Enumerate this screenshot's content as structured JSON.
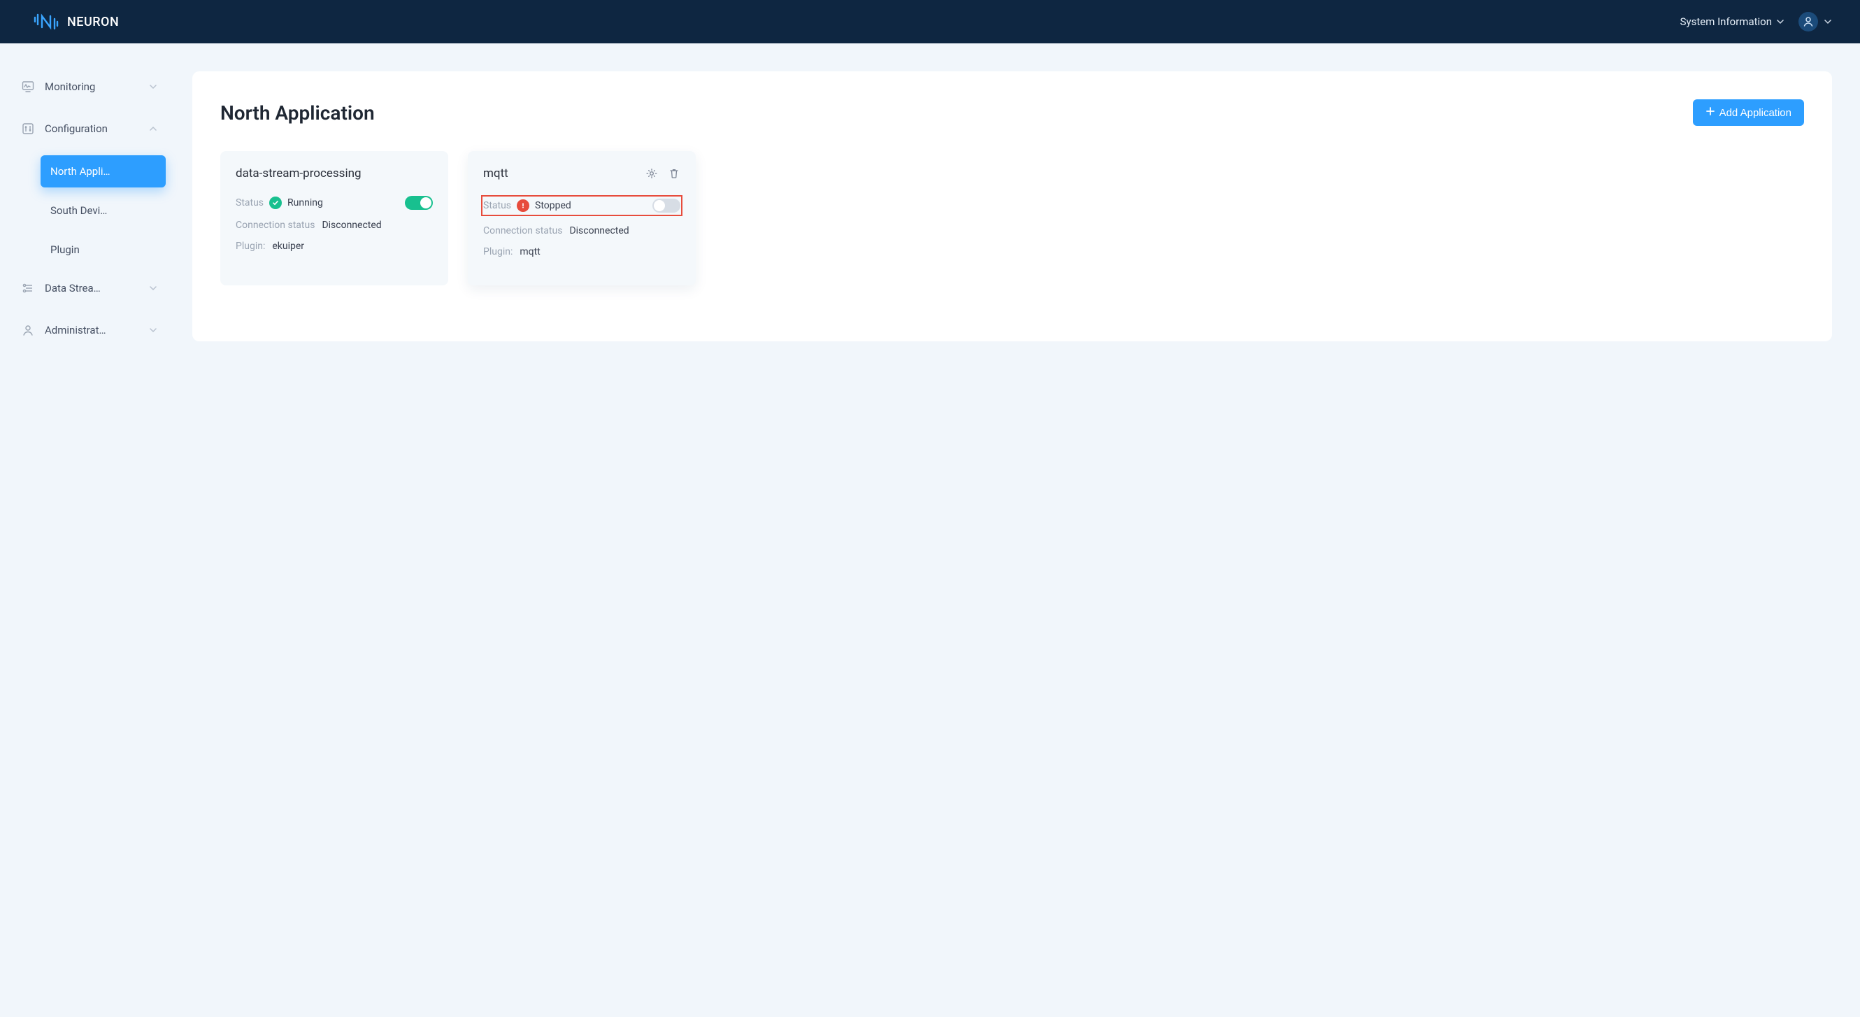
{
  "brand": {
    "name": "NEURON"
  },
  "header": {
    "system_info_label": "System Information"
  },
  "sidebar": {
    "monitoring_label": "Monitoring",
    "configuration_label": "Configuration",
    "north_app_label": "North Appli…",
    "south_dev_label": "South Devi…",
    "plugin_label": "Plugin",
    "data_stream_label": "Data Strea…",
    "administration_label": "Administrat…"
  },
  "main": {
    "title": "North Application",
    "add_button_label": "Add Application",
    "labels": {
      "status": "Status",
      "connection_status": "Connection status",
      "plugin": "Plugin:"
    },
    "apps": [
      {
        "name": "data-stream-processing",
        "status": "Running",
        "status_state": "green",
        "switch_on": true,
        "connection_status": "Disconnected",
        "plugin": "ekuiper",
        "show_actions": false,
        "highlight_status": false
      },
      {
        "name": "mqtt",
        "status": "Stopped",
        "status_state": "red",
        "switch_on": false,
        "connection_status": "Disconnected",
        "plugin": "mqtt",
        "show_actions": true,
        "highlight_status": true
      }
    ]
  }
}
